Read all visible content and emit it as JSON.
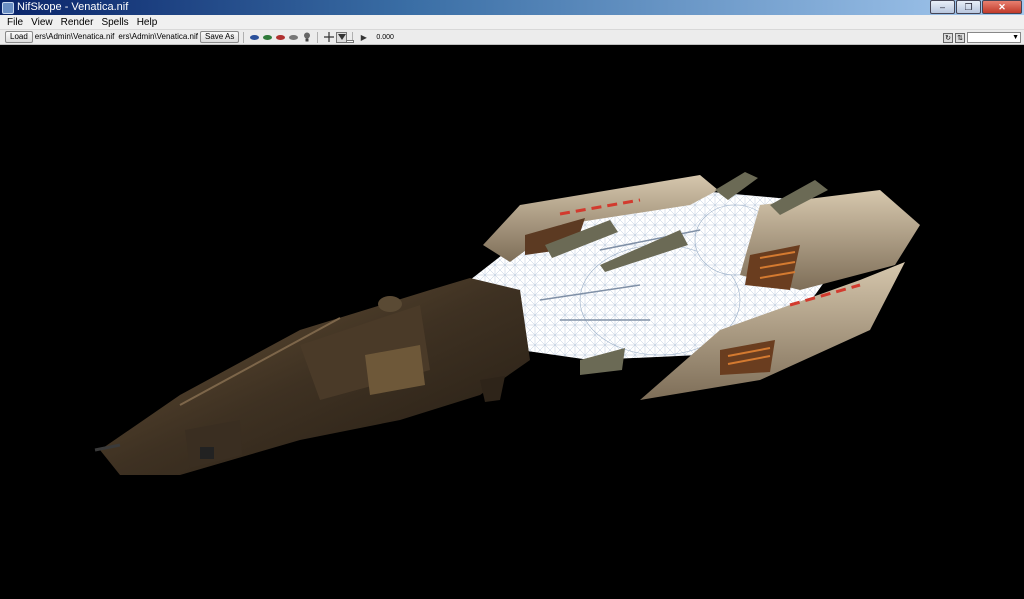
{
  "window": {
    "title": "NifSkope - Venatica.nif",
    "minimize": "–",
    "maximize": "❐",
    "close": "✕"
  },
  "menu": {
    "items": [
      "File",
      "View",
      "Render",
      "Spells",
      "Help"
    ]
  },
  "toolbar": {
    "load_label": "Load",
    "load_path": "ers\\Admin\\Venatica.nif",
    "save_path": "ers\\Admin\\Venatica.nif",
    "save_as_label": "Save As",
    "play_icon": "▶",
    "time_value": "0.000",
    "eye_icon_colors": [
      "#2a4f9a",
      "#2f7a3a",
      "#b03030",
      "#777777"
    ],
    "light_icon": "bulb-icon",
    "axes_icon": "axes-icon",
    "view_icon": "view-dropdown-icon"
  },
  "right_tools": {
    "combo_value": ""
  }
}
